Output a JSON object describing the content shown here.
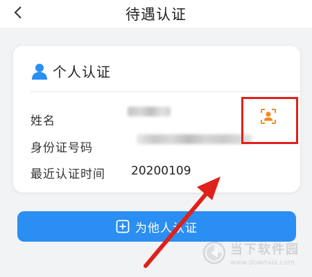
{
  "header": {
    "title": "待遇认证",
    "back_icon": "chevron-left-icon"
  },
  "card": {
    "icon": "person-icon",
    "title": "个人认证",
    "rows": [
      {
        "label": "姓名",
        "value": ""
      },
      {
        "label": "身份证号码",
        "value": ""
      },
      {
        "label": "最近认证时间",
        "value": "20200109"
      }
    ],
    "face_scan_icon": "face-scan-icon"
  },
  "action": {
    "icon": "plus-square-icon",
    "label": "为他人认证"
  },
  "watermark": {
    "text": "当下软件园",
    "url": "www.downxia.com"
  },
  "colors": {
    "accent_blue": "#2a8ef2",
    "face_icon_orange": "#f08a24",
    "highlight_red": "#e0201a"
  }
}
